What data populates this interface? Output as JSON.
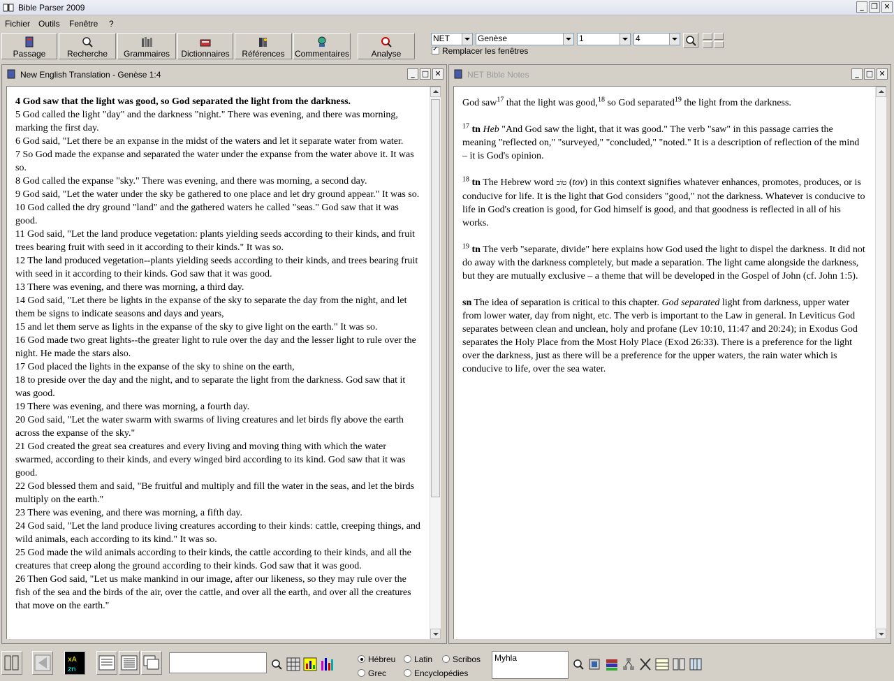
{
  "app": {
    "title": "Bible Parser 2009"
  },
  "menu": [
    "Fichier",
    "Outils",
    "Fenêtre",
    "?"
  ],
  "toolbar": {
    "buttons": [
      {
        "label": "Passage",
        "icon": "book-icon"
      },
      {
        "label": "Recherche",
        "icon": "search-icon"
      },
      {
        "label": "Grammaires",
        "icon": "grammar-icon"
      },
      {
        "label": "Dictionnaires",
        "icon": "dictionary-icon"
      },
      {
        "label": "Références",
        "icon": "references-icon"
      },
      {
        "label": "Commentaires",
        "icon": "commentary-icon"
      },
      {
        "label": "Analyse",
        "icon": "analysis-icon"
      }
    ],
    "version": "NET",
    "book": "Genèse",
    "chapter": "1",
    "verse": "4",
    "replace_windows_label": "Remplacer les fenêtres"
  },
  "left_window": {
    "title": "New English Translation - Genèse 1:4",
    "verses": [
      "4 God saw that the light was good, so God separated the light from the darkness.",
      "5 God called the light \"day\" and the darkness \"night.\" There was evening, and there was morning, marking the first day.",
      "6 God said, \"Let there be an expanse in the midst of the waters and let it separate water from water.",
      "7 So God made the expanse and separated the water under the expanse from the water above it. It was so.",
      "8 God called the expanse \"sky.\" There was evening, and there was morning, a second day.",
      "9 God said, \"Let the water under the sky be gathered to one place and let dry ground appear.\" It was so.",
      "10 God called the dry ground \"land\" and the gathered waters he called \"seas.\" God saw that it was good.",
      "11 God said, \"Let the land produce vegetation: plants yielding seeds according to their kinds, and fruit trees bearing fruit with seed in it according to their kinds.\" It was so.",
      "12 The land produced vegetation--plants yielding seeds according to their kinds, and trees bearing fruit with seed in it according to their kinds. God saw that it was good.",
      "13 There was evening, and there was morning, a third day.",
      "14 God said, \"Let there be lights in the expanse of the sky to separate the day from the night, and let them be signs to indicate seasons and days and years,",
      "15 and let them serve as lights in the expanse of the sky to give light on the earth.\" It was so.",
      "16 God made two great lights--the greater light to rule over the day and the lesser light to rule over the night. He made the stars also.",
      "17 God placed the lights in the expanse of the sky to shine on the earth,",
      "18 to preside over the day and the night, and to separate the light from the darkness. God saw that it was good.",
      "19 There was evening, and there was morning, a fourth day.",
      "20 God said, \"Let the water swarm with swarms of living creatures and let birds fly above the earth across the expanse of the sky.\"",
      "21 God created the great sea creatures and every living and moving thing with which the water swarmed, according to their kinds, and every winged bird according to its kind. God saw that it was good.",
      "22 God blessed them and said, \"Be fruitful and multiply and fill the water in the seas, and let the birds multiply on the earth.\"",
      "23 There was evening, and there was morning, a fifth day.",
      "24 God said, \"Let the land produce living creatures according to their kinds: cattle, creeping things, and wild animals, each according to its kind.\" It was so.",
      "25 God made the wild animals according to their kinds, the cattle according to their kinds, and all the creatures that creep along the ground according to their kinds. God saw that it was good.",
      "26 Then God said, \"Let us make mankind in our image, after our likeness, so they may rule over the fish of the sea and the birds of the air, over the cattle, and over all the earth, and over all the creatures that move on the earth.\""
    ]
  },
  "right_window": {
    "title": "NET Bible Notes",
    "main": {
      "p1": "God saw",
      "s1": "17",
      "p2": " that the light was good,",
      "s2": "18",
      "p3": " so God separated",
      "s3": "19",
      "p4": " the light from the darkness."
    },
    "note17": {
      "num": "17",
      "tag": "tn",
      "heb": "Heb",
      "text": " \"And God saw the light, that it was good.\" The verb \"saw\" in this passage carries the meaning \"reflected on,\" \"surveyed,\" \"concluded,\" \"noted.\" It is a description of reflection of the mind – it is God's opinion."
    },
    "note18": {
      "num": "18",
      "tag": "tn",
      "t1": " The Hebrew word ",
      "hebrew": "טוֹב",
      "t2": " (",
      "tov": "tov",
      "t3": ") in this context signifies whatever enhances, promotes, produces, or is conducive for life. It is the light that God considers \"good,\" not the darkness. Whatever is conducive to life in God's creation is good, for God himself is good, and that goodness is reflected in all of his works."
    },
    "note19": {
      "num": "19",
      "tag": "tn",
      "text": " The verb \"separate, divide\" here explains how God used the light to dispel the darkness. It did not do away with the darkness completely, but made a separation. The light came alongside the darkness, but they are mutually exclusive – a theme that will be developed in the Gospel of John (cf. John 1:5)."
    },
    "note_sn": {
      "tag": "sn",
      "t1": " The idea of separation is critical to this chapter. ",
      "em": "God separated",
      "t2": " light from darkness, upper water from lower water, day from night, etc. The verb is important to the Law in general. In Leviticus God separates between clean and unclean, holy and profane (Lev 10:10, 11:47 and 20:24); in Exodus God separates the Holy Place from the Most Holy Place (Exod 26:33). There is a preference for the light over the darkness, just as there will be a preference for the upper waters, the rain water which is conducive to life, over the sea water."
    }
  },
  "bottom": {
    "search_value": "",
    "radios": [
      {
        "label": "Hébreu",
        "checked": true
      },
      {
        "label": "Latin",
        "checked": false
      },
      {
        "label": "Scribos",
        "checked": false
      },
      {
        "label": "Grec",
        "checked": false
      },
      {
        "label": "Encyclopédies",
        "checked": false
      }
    ],
    "word_value": "Myhla"
  }
}
